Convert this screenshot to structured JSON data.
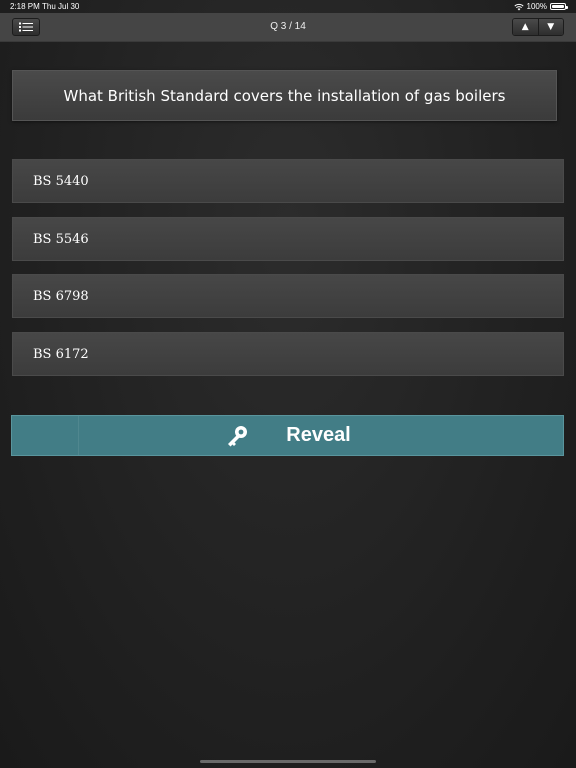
{
  "status_bar": {
    "time": "2:18 PM",
    "date": "Thu Jul 30",
    "battery": "100%"
  },
  "navbar": {
    "title": "Q 3 / 14",
    "up_arrow": "▲",
    "down_arrow": "▼"
  },
  "question": {
    "text": "What British Standard covers the installation of gas boilers"
  },
  "answers": [
    {
      "label": "BS 5440"
    },
    {
      "label": "BS 5546"
    },
    {
      "label": "BS 6798"
    },
    {
      "label": "BS 6172"
    }
  ],
  "reveal": {
    "label": "Reveal"
  },
  "colors": {
    "accent": "#427d86",
    "background": "#222222",
    "bar": "#454545"
  }
}
